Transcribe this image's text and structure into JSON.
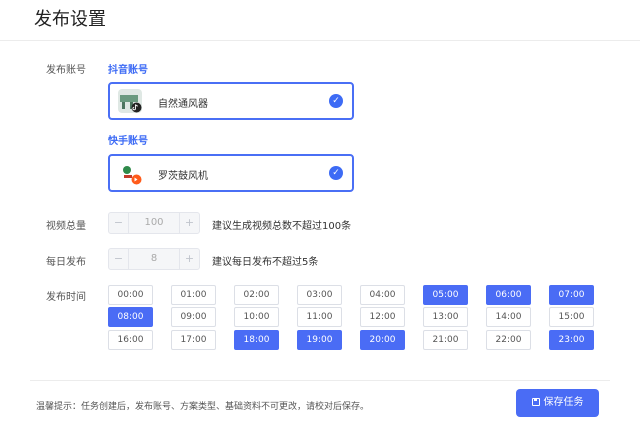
{
  "page": {
    "title": "发布设置"
  },
  "labels": {
    "account": "发布账号",
    "total": "视频总量",
    "daily": "每日发布",
    "time": "发布时间"
  },
  "platforms": {
    "douyin": {
      "label": "抖音账号",
      "account_name": "自然通风器",
      "selected": true
    },
    "kuaishou": {
      "label": "快手账号",
      "account_name": "罗茨鼓风机",
      "selected": true
    }
  },
  "total": {
    "minus": "−",
    "value": "100",
    "plus": "+",
    "hint": "建议生成视频总数不超过100条"
  },
  "daily": {
    "minus": "−",
    "value": "8",
    "plus": "+",
    "hint": "建议每日发布不超过5条"
  },
  "times": [
    {
      "label": "00:00",
      "selected": false
    },
    {
      "label": "01:00",
      "selected": false
    },
    {
      "label": "02:00",
      "selected": false
    },
    {
      "label": "03:00",
      "selected": false
    },
    {
      "label": "04:00",
      "selected": false
    },
    {
      "label": "05:00",
      "selected": true
    },
    {
      "label": "06:00",
      "selected": true
    },
    {
      "label": "07:00",
      "selected": true
    },
    {
      "label": "08:00",
      "selected": true
    },
    {
      "label": "09:00",
      "selected": false
    },
    {
      "label": "10:00",
      "selected": false
    },
    {
      "label": "11:00",
      "selected": false
    },
    {
      "label": "12:00",
      "selected": false
    },
    {
      "label": "13:00",
      "selected": false
    },
    {
      "label": "14:00",
      "selected": false
    },
    {
      "label": "15:00",
      "selected": false
    },
    {
      "label": "16:00",
      "selected": false
    },
    {
      "label": "17:00",
      "selected": false
    },
    {
      "label": "18:00",
      "selected": true
    },
    {
      "label": "19:00",
      "selected": true
    },
    {
      "label": "20:00",
      "selected": true
    },
    {
      "label": "21:00",
      "selected": false
    },
    {
      "label": "22:00",
      "selected": false
    },
    {
      "label": "23:00",
      "selected": true
    }
  ],
  "footer": {
    "tip": "温馨提示：任务创建后，发布账号、方案类型、基础资料不可更改，请校对后保存。",
    "save_label": "保存任务"
  },
  "colors": {
    "accent": "#4a6cf5",
    "link": "#3d6bf5"
  }
}
